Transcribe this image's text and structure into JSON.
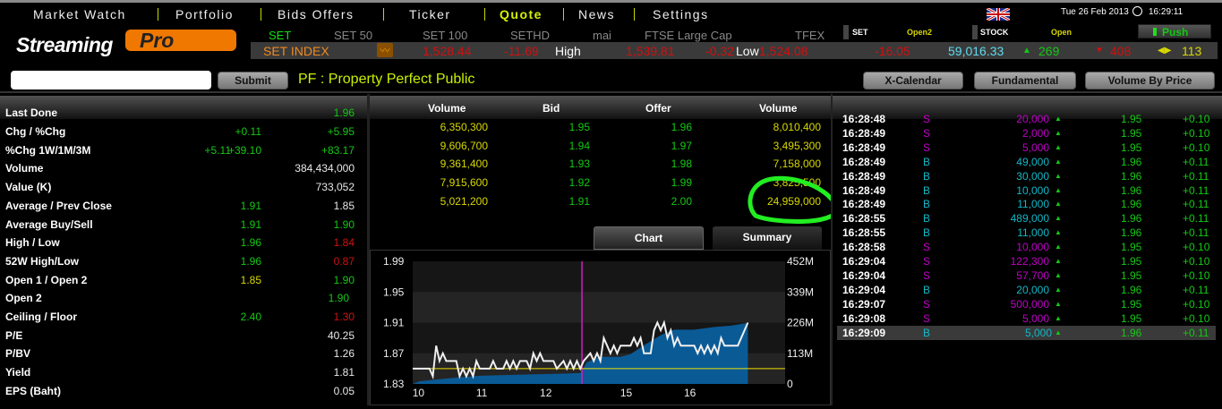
{
  "nav": {
    "items": [
      "Market Watch",
      "Portfolio",
      "Bids Offers",
      "Ticker",
      "Quote",
      "News",
      "Settings"
    ],
    "active": "Quote"
  },
  "header": {
    "logo_text": "StreamingPro",
    "date": "Tue 26 Feb 2013",
    "time": "16:29:11",
    "flag": "uk-flag-icon"
  },
  "index_tabs": [
    "SET",
    "SET 50",
    "SET 100",
    "SETHD",
    "mai",
    "FTSE Large Cap",
    "TFEX"
  ],
  "status": {
    "set_label": "SET",
    "set_state": "Open2",
    "stock_label": "STOCK",
    "stock_state": "Open",
    "push_label": "Push"
  },
  "index_bar": {
    "name": "SET INDEX",
    "last": "1,528.44",
    "chg": "-11.69",
    "high_label": "High",
    "high": "1,539.81",
    "high_chg": "-0.32",
    "low_label": "Low",
    "low": "1,524.08",
    "low_chg": "-16.05",
    "value": "59,016.33",
    "up": "269",
    "down": "408",
    "unchanged": "113"
  },
  "search": {
    "value": "",
    "submit_label": "Submit"
  },
  "symbol_title": "PF : Property Perfect Public",
  "buttons": {
    "xcal": "X-Calendar",
    "fund": "Fundamental",
    "vbp": "Volume By Price"
  },
  "quote": [
    {
      "label": "Last Done",
      "v2": "1.96",
      "c2": "green"
    },
    {
      "label": "Chg / %Chg",
      "v1": "+0.11",
      "c1": "green",
      "v2": "+5.95",
      "c2": "green"
    },
    {
      "label": "%Chg 1W/1M/3M",
      "v0": "+5.11",
      "v1": "+39.10",
      "v2": "+83.17",
      "c0": "green",
      "c1": "green",
      "c2": "green"
    },
    {
      "label": "Volume",
      "v2": "384,434,000",
      "c2": "white"
    },
    {
      "label": "Value (K)",
      "v2": "733,052",
      "c2": "white"
    },
    {
      "label": "Average / Prev Close",
      "v1": "1.91",
      "c1": "green",
      "v2": "1.85",
      "c2": "white"
    },
    {
      "label": "Average Buy/Sell",
      "v1": "1.91",
      "c1": "green",
      "v2": "1.90",
      "c2": "green"
    },
    {
      "label": "High / Low",
      "v1": "1.96",
      "c1": "green",
      "v2": "1.84",
      "c2": "red"
    },
    {
      "label": "52W High/Low",
      "v1": "1.96",
      "c1": "green",
      "v2": "0.87",
      "c2": "red"
    },
    {
      "label": "Open 1 / Open 2",
      "v1": "1.85",
      "c1": "yel",
      "v2": "1.90",
      "c2": "green"
    },
    {
      "label": "Open 2",
      "v2": "1.90",
      "c2": "green"
    },
    {
      "label": "Ceiling / Floor",
      "v1": "2.40",
      "c1": "green",
      "v2": "1.30",
      "c2": "red"
    },
    {
      "label": "P/E",
      "v2": "40.25",
      "c2": "white"
    },
    {
      "label": "P/BV",
      "v2": "1.26",
      "c2": "white"
    },
    {
      "label": "Yield",
      "v2": "1.81",
      "c2": "white"
    },
    {
      "label": "EPS (Baht)",
      "v2": "0.05",
      "c2": "white"
    }
  ],
  "bidoffer": {
    "headers": [
      "Volume",
      "Bid",
      "Offer",
      "Volume"
    ],
    "rows": [
      [
        "6,350,300",
        "1.95",
        "1.96",
        "8,010,400"
      ],
      [
        "9,606,700",
        "1.94",
        "1.97",
        "3,495,300"
      ],
      [
        "9,361,400",
        "1.93",
        "1.98",
        "7,158,000"
      ],
      [
        "7,915,600",
        "1.92",
        "1.99",
        "3,825,500"
      ],
      [
        "5,021,200",
        "1.91",
        "2.00",
        "24,959,000"
      ]
    ]
  },
  "tabs": {
    "chart": "Chart",
    "summary": "Summary"
  },
  "ticker": [
    [
      "16:28:48",
      "S",
      "20,000",
      "1.95",
      "+0.10"
    ],
    [
      "16:28:49",
      "S",
      "2,000",
      "1.95",
      "+0.10"
    ],
    [
      "16:28:49",
      "S",
      "5,000",
      "1.95",
      "+0.10"
    ],
    [
      "16:28:49",
      "B",
      "49,000",
      "1.96",
      "+0.11"
    ],
    [
      "16:28:49",
      "B",
      "30,000",
      "1.96",
      "+0.11"
    ],
    [
      "16:28:49",
      "B",
      "10,000",
      "1.96",
      "+0.11"
    ],
    [
      "16:28:49",
      "B",
      "11,000",
      "1.96",
      "+0.11"
    ],
    [
      "16:28:55",
      "B",
      "489,000",
      "1.96",
      "+0.11"
    ],
    [
      "16:28:55",
      "B",
      "11,000",
      "1.96",
      "+0.11"
    ],
    [
      "16:28:58",
      "S",
      "10,000",
      "1.95",
      "+0.10"
    ],
    [
      "16:29:04",
      "S",
      "122,300",
      "1.95",
      "+0.10"
    ],
    [
      "16:29:04",
      "S",
      "57,700",
      "1.95",
      "+0.10"
    ],
    [
      "16:29:04",
      "B",
      "20,000",
      "1.96",
      "+0.11"
    ],
    [
      "16:29:07",
      "S",
      "500,000",
      "1.95",
      "+0.10"
    ],
    [
      "16:29:08",
      "S",
      "5,000",
      "1.95",
      "+0.10"
    ],
    [
      "16:29:09",
      "B",
      "5,000",
      "1.96",
      "+0.11"
    ]
  ],
  "chart_data": {
    "type": "line",
    "title": "",
    "y_left_ticks": [
      "1.99",
      "1.95",
      "1.91",
      "1.87",
      "1.83"
    ],
    "y_left_range": [
      1.83,
      1.99
    ],
    "y_right_ticks": [
      "452M",
      "339M",
      "226M",
      "113M",
      "0"
    ],
    "y_right_range": [
      0,
      452
    ],
    "x_ticks": [
      {
        "label": "10",
        "x": 1
      },
      {
        "label": "11",
        "x": 20
      },
      {
        "label": "12",
        "x": 39
      },
      {
        "label": "15",
        "x": 63
      },
      {
        "label": "16",
        "x": 82
      }
    ],
    "x_range": [
      0,
      100
    ],
    "prev_close": 1.85,
    "break_x": 50.5,
    "price": [
      [
        0,
        1.85
      ],
      [
        5,
        1.85
      ],
      [
        6,
        1.84
      ],
      [
        7,
        1.88
      ],
      [
        8,
        1.86
      ],
      [
        9,
        1.87
      ],
      [
        10,
        1.86
      ],
      [
        13,
        1.86
      ],
      [
        14,
        1.84
      ],
      [
        15,
        1.85
      ],
      [
        16,
        1.84
      ],
      [
        17,
        1.85
      ],
      [
        18,
        1.84
      ],
      [
        19,
        1.86
      ],
      [
        20,
        1.85
      ],
      [
        23,
        1.85
      ],
      [
        24,
        1.86
      ],
      [
        25,
        1.85
      ],
      [
        27,
        1.85
      ],
      [
        28,
        1.86
      ],
      [
        29,
        1.85
      ],
      [
        30,
        1.86
      ],
      [
        31,
        1.85
      ],
      [
        32,
        1.86
      ],
      [
        34,
        1.86
      ],
      [
        35,
        1.85
      ],
      [
        36,
        1.87
      ],
      [
        37,
        1.86
      ],
      [
        38,
        1.87
      ],
      [
        39,
        1.86
      ],
      [
        42,
        1.86
      ],
      [
        43,
        1.85
      ],
      [
        45,
        1.86
      ],
      [
        46,
        1.85
      ],
      [
        47,
        1.86
      ],
      [
        48,
        1.85
      ],
      [
        49,
        1.86
      ],
      [
        50,
        1.85
      ],
      [
        51,
        1.86
      ],
      [
        53,
        1.87
      ],
      [
        54,
        1.86
      ],
      [
        55,
        1.87
      ],
      [
        56,
        1.86
      ],
      [
        57,
        1.89
      ],
      [
        58,
        1.88
      ],
      [
        59,
        1.87
      ],
      [
        60,
        1.88
      ],
      [
        61,
        1.87
      ],
      [
        62,
        1.88
      ],
      [
        65,
        1.88
      ],
      [
        66,
        1.89
      ],
      [
        67,
        1.88
      ],
      [
        68,
        1.89
      ],
      [
        69,
        1.87
      ],
      [
        71,
        1.87
      ],
      [
        72,
        1.9
      ],
      [
        73,
        1.91
      ],
      [
        74,
        1.9
      ],
      [
        75,
        1.91
      ],
      [
        76,
        1.89
      ],
      [
        77,
        1.9
      ],
      [
        78,
        1.88
      ],
      [
        79,
        1.89
      ],
      [
        80,
        1.88
      ],
      [
        84,
        1.88
      ],
      [
        85,
        1.87
      ],
      [
        86,
        1.88
      ],
      [
        87,
        1.87
      ],
      [
        88,
        1.88
      ],
      [
        89,
        1.87
      ],
      [
        90,
        1.88
      ],
      [
        91,
        1.87
      ],
      [
        92,
        1.89
      ],
      [
        93,
        1.88
      ],
      [
        97,
        1.88
      ],
      [
        98,
        1.89
      ],
      [
        99,
        1.9
      ],
      [
        100,
        1.91
      ]
    ],
    "volume_M": [
      [
        0,
        0
      ],
      [
        2,
        10
      ],
      [
        10,
        20
      ],
      [
        20,
        30
      ],
      [
        35,
        35
      ],
      [
        45,
        38
      ],
      [
        50,
        40
      ],
      [
        52,
        80
      ],
      [
        56,
        100
      ],
      [
        62,
        100
      ],
      [
        65,
        110
      ],
      [
        70,
        150
      ],
      [
        74,
        180
      ],
      [
        78,
        200
      ],
      [
        84,
        200
      ],
      [
        90,
        210
      ],
      [
        95,
        215
      ],
      [
        100,
        225
      ]
    ]
  }
}
